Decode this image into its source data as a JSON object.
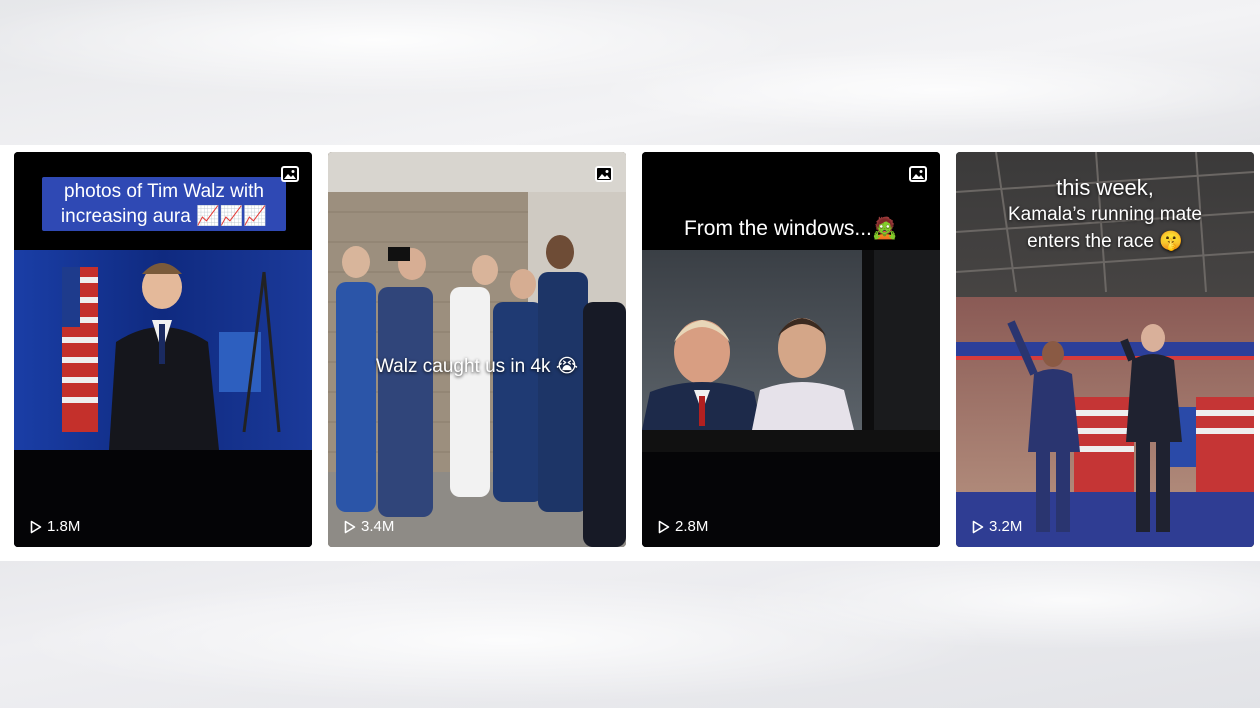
{
  "cards": [
    {
      "caption": [
        "photos of Tim Walz with",
        "increasing aura 📈📈📈"
      ],
      "views": "1.8M",
      "has_slideshow_icon": true
    },
    {
      "caption": "Walz caught us in 4k 😭",
      "views": "3.4M",
      "has_slideshow_icon": true
    },
    {
      "caption": "From the windows...🧟",
      "views": "2.8M",
      "has_slideshow_icon": true
    },
    {
      "caption": [
        "this week,",
        "Kamala’s running mate",
        "enters the race 🤫"
      ],
      "views": "3.2M",
      "has_slideshow_icon": false
    }
  ],
  "icons": {
    "slideshow": "image-icon",
    "views": "play-icon"
  },
  "colors": {
    "caption_box": "#2f49b4",
    "card_bg": "#000000",
    "text": "#ffffff"
  }
}
